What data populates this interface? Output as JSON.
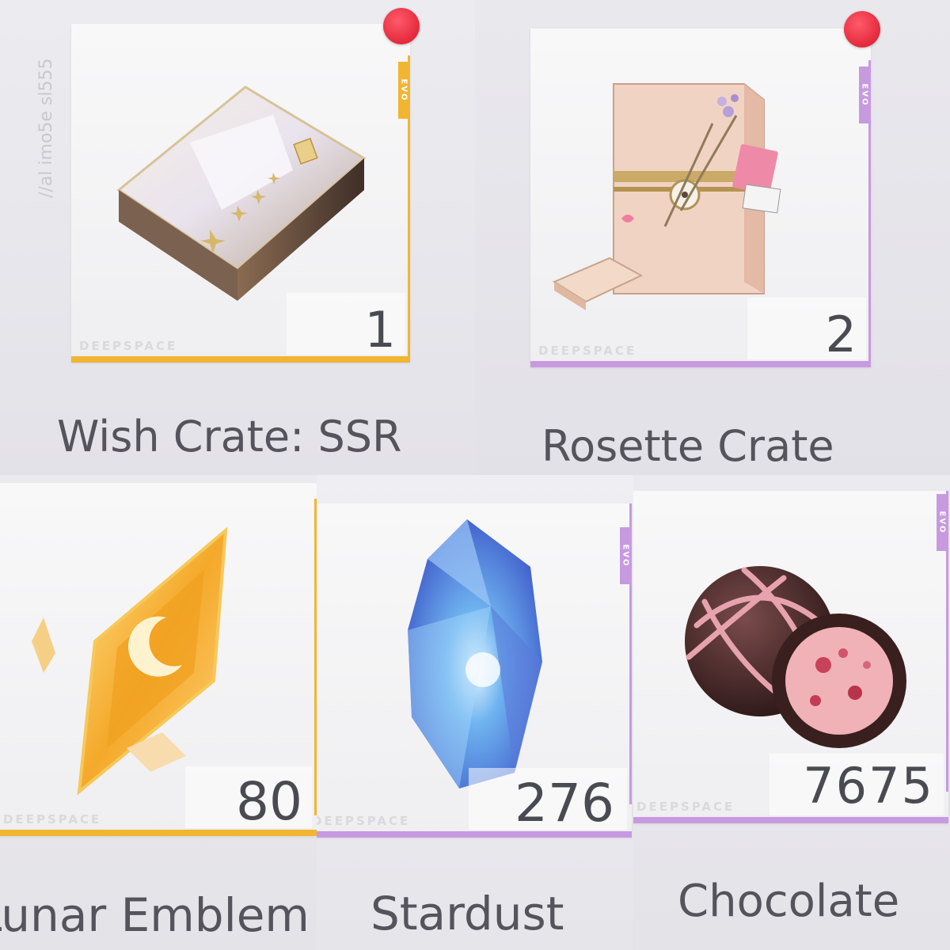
{
  "accent_colors": {
    "ssr_gold": "#f2b531",
    "rare_purple": "#c79ae0",
    "badge_red": "#ee3344"
  },
  "items": [
    {
      "name": "Wish Crate: SSR",
      "quantity": "1",
      "badge": "EVO",
      "rarity_color": "#f2b531",
      "new_dot": true,
      "brand": "DEEPSPACE",
      "icon": "wish-crate-icon"
    },
    {
      "name": "Rosette Crate",
      "quantity": "2",
      "badge": "EVO",
      "rarity_color": "#c79ae0",
      "new_dot": true,
      "brand": "DEEPSPACE",
      "icon": "rosette-crate-icon"
    },
    {
      "name": "Lunar Emblem",
      "quantity": "80",
      "rarity_color": "#f2b531",
      "brand": "DEEPSPACE",
      "icon": "lunar-emblem-icon"
    },
    {
      "name": "Stardust",
      "quantity": "276",
      "badge": "EVO",
      "rarity_color": "#c79ae0",
      "brand": "DEEPSPACE",
      "icon": "stardust-icon"
    },
    {
      "name": "Chocolate",
      "quantity": "7675",
      "badge": "EVO",
      "rarity_color": "#c79ae0",
      "brand": "DEEPSPACE",
      "icon": "chocolate-icon"
    }
  ],
  "watermark_text": "//al imo5e sl555"
}
